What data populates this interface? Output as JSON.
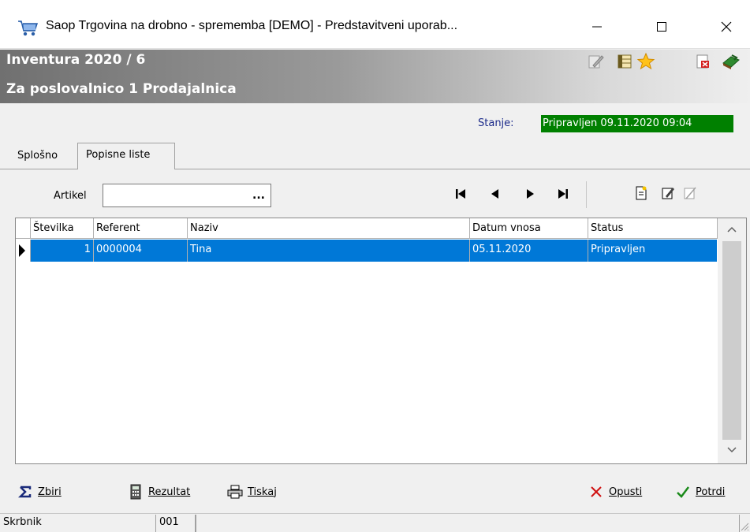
{
  "window": {
    "title": "Saop Trgovina na drobno - sprememba [DEMO] - Predstavitveni uporab...",
    "minimize_glyph": "—",
    "maximize_glyph": "☐",
    "close_glyph": "✕"
  },
  "header": {
    "title": "Inventura 2020 / 6",
    "subtitle": "Za poslovalnico 1 Prodajalnica",
    "icons": [
      "edit-icon",
      "columns-icon",
      "star-icon",
      "delete-doc-icon",
      "exit-book-icon"
    ]
  },
  "state": {
    "label": "Stanje:",
    "value": "Pripravljen 09.11.2020 09:04",
    "value_bg": "#008000"
  },
  "tabs": [
    {
      "label": "Splošno",
      "active": false
    },
    {
      "label": "Popisne liste",
      "active": true
    }
  ],
  "filter": {
    "artikel_label": "Artikel",
    "artikel_value": "",
    "browse_label": "..."
  },
  "grid": {
    "columns": [
      "Številka",
      "Referent",
      "Naziv",
      "Datum vnosa",
      "Status"
    ],
    "rows": [
      {
        "stevilka": "1",
        "referent": "0000004",
        "naziv": "Tina",
        "datum_vnosa": "05.11.2020",
        "status": "Pripravljen",
        "selected": true
      }
    ],
    "selection_color": "#0078d7"
  },
  "footer": {
    "zbiri": "Zbiri",
    "rezultat": "Rezultat",
    "tiskaj": "Tiskaj",
    "opusti": "Opusti",
    "potrdi": "Potrdi"
  },
  "statusbar": {
    "panel1": "Skrbnik",
    "panel2": "001",
    "panel3": ""
  }
}
